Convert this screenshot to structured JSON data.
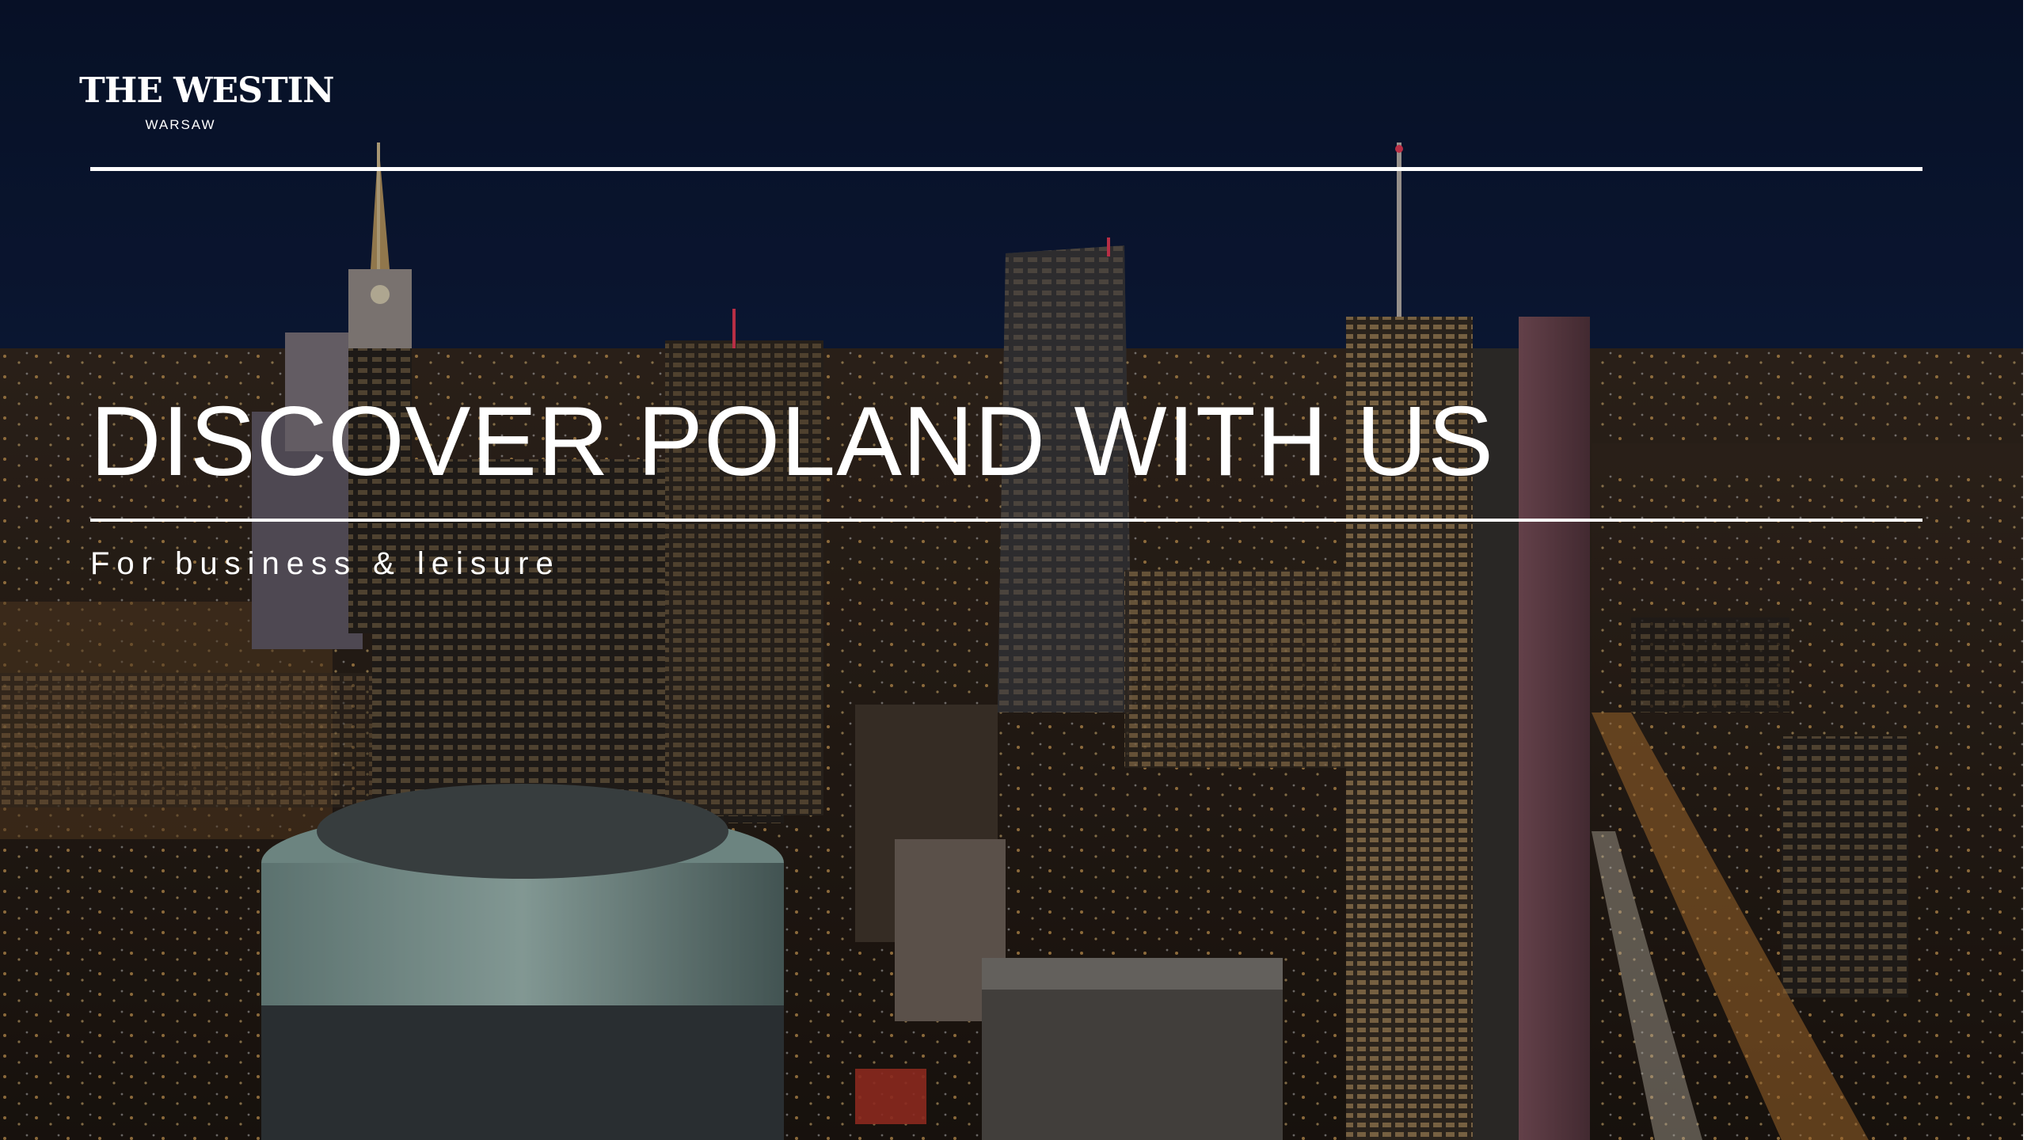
{
  "brand": {
    "name": "THE WESTIN",
    "location": "WARSAW"
  },
  "hero": {
    "headline": "DISCOVER POLAND WITH US",
    "tagline": "For business & leisure"
  },
  "colors": {
    "sky_top": "#0b1633",
    "text": "#ffffff"
  },
  "background": {
    "description_icon": "city-night-skyline-image"
  }
}
